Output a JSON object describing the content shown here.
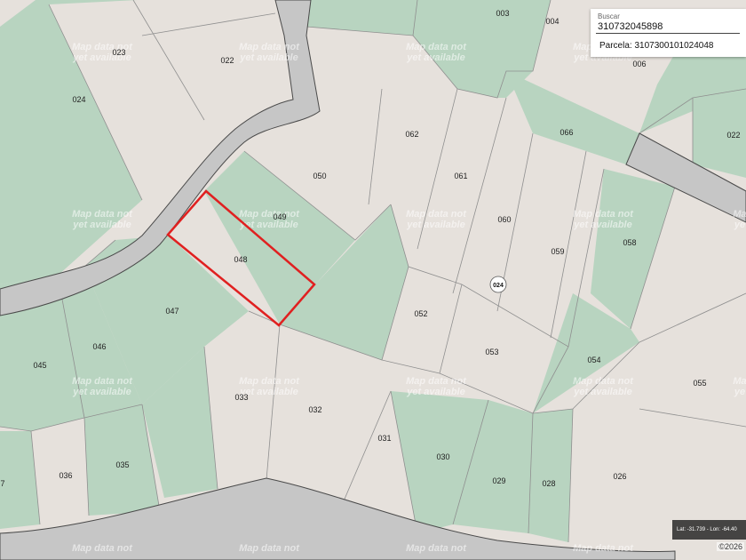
{
  "map": {
    "parcels": [
      {
        "id": "p003",
        "label": "003"
      },
      {
        "id": "p004",
        "label": "004"
      },
      {
        "id": "p006",
        "label": "006"
      },
      {
        "id": "p022a",
        "label": "022"
      },
      {
        "id": "p022b",
        "label": "022"
      },
      {
        "id": "p023",
        "label": "023"
      },
      {
        "id": "p024",
        "label": "024"
      },
      {
        "id": "p026",
        "label": "026"
      },
      {
        "id": "p028",
        "label": "028"
      },
      {
        "id": "p029",
        "label": "029"
      },
      {
        "id": "p030",
        "label": "030"
      },
      {
        "id": "p031",
        "label": "031"
      },
      {
        "id": "p032",
        "label": "032"
      },
      {
        "id": "p033",
        "label": "033"
      },
      {
        "id": "p035",
        "label": "035"
      },
      {
        "id": "p036",
        "label": "036"
      },
      {
        "id": "p037",
        "label": "7"
      },
      {
        "id": "p045",
        "label": "045"
      },
      {
        "id": "p046",
        "label": "046"
      },
      {
        "id": "p047",
        "label": "047"
      },
      {
        "id": "p048",
        "label": "048"
      },
      {
        "id": "p049",
        "label": "049"
      },
      {
        "id": "p050",
        "label": "050"
      },
      {
        "id": "p052",
        "label": "052"
      },
      {
        "id": "p053",
        "label": "053"
      },
      {
        "id": "p054",
        "label": "054"
      },
      {
        "id": "p055",
        "label": "055"
      },
      {
        "id": "p058",
        "label": "058"
      },
      {
        "id": "p059",
        "label": "059"
      },
      {
        "id": "p060",
        "label": "060"
      },
      {
        "id": "p061",
        "label": "061"
      },
      {
        "id": "p062",
        "label": "062"
      },
      {
        "id": "p066",
        "label": "066"
      }
    ],
    "block_label": "024",
    "watermark_line1": "Map data not",
    "watermark_line2": "yet available",
    "watermark_line1_partial": "Ma",
    "watermark_line2_partial": "ye",
    "selected_parcel": "048",
    "colors": {
      "base": "#e6e1dc",
      "green": "#b8d4c0",
      "road": "#c6c6c6",
      "road_edge": "#4a4a4a",
      "boundary": "#8f8f8f",
      "selection": "#e02020"
    }
  },
  "search": {
    "caption": "Buscar",
    "value": "310732045898",
    "result": "Parcela: 3107300101024048"
  },
  "status": {
    "coords": "Lat: -31.739 - Lon: -64.40",
    "copyright": "©2026"
  }
}
